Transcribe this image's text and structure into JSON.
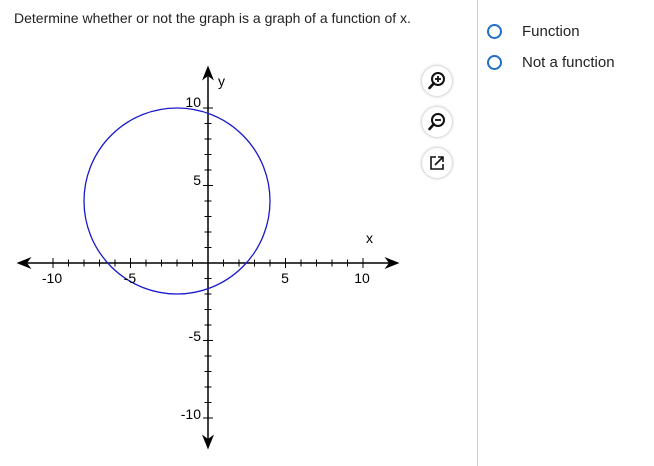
{
  "question": {
    "text": "Determine whether or not the graph is a graph of a function of x."
  },
  "options": [
    {
      "label": "Function",
      "selected": false
    },
    {
      "label": "Not a function",
      "selected": false
    }
  ],
  "graph": {
    "x_axis_label": "x",
    "y_axis_label": "y",
    "xlim": [
      -11,
      11
    ],
    "ylim": [
      -11,
      11
    ],
    "x_tick_labels": [
      "-10",
      "-5",
      "5",
      "10"
    ],
    "y_tick_labels": [
      "10",
      "5",
      "-5",
      "-10"
    ],
    "circle": {
      "center_x": -2,
      "center_y": 4,
      "radius": 6
    },
    "circle_color": "#1a1acc"
  },
  "tools": [
    {
      "name": "zoom-in-icon"
    },
    {
      "name": "zoom-out-icon"
    },
    {
      "name": "open-new-window-icon"
    }
  ]
}
